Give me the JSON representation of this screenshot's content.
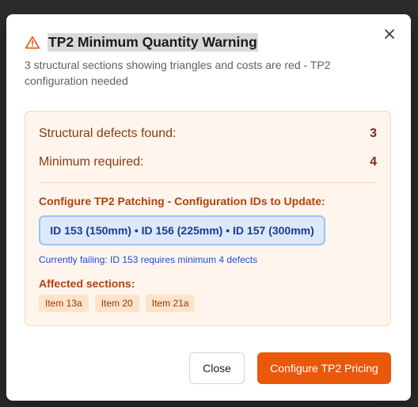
{
  "dialog": {
    "title": "TP2 Minimum Quantity Warning",
    "subtitle": "3 structural sections showing triangles and costs are red - TP2 configuration needed",
    "close_icon": "close-icon",
    "warning_icon": "warning-triangle-icon"
  },
  "stats": {
    "defects_label": "Structural defects found:",
    "defects_value": "3",
    "minimum_label": "Minimum required:",
    "minimum_value": "4"
  },
  "config": {
    "heading": "Configure TP2 Patching - Configuration IDs to Update:",
    "ids": "ID 153 (150mm) • ID 156 (225mm) • ID 157 (300mm)",
    "failing": "Currently failing: ID 153 requires minimum 4 defects"
  },
  "affected": {
    "heading": "Affected sections:",
    "items": [
      "Item 13a",
      "Item 20",
      "Item 21a"
    ]
  },
  "buttons": {
    "close": "Close",
    "configure": "Configure TP2 Pricing"
  },
  "colors": {
    "accent": "#ea580c",
    "panel_bg": "#fff5ec",
    "id_box_bg": "#dbe9fd"
  }
}
